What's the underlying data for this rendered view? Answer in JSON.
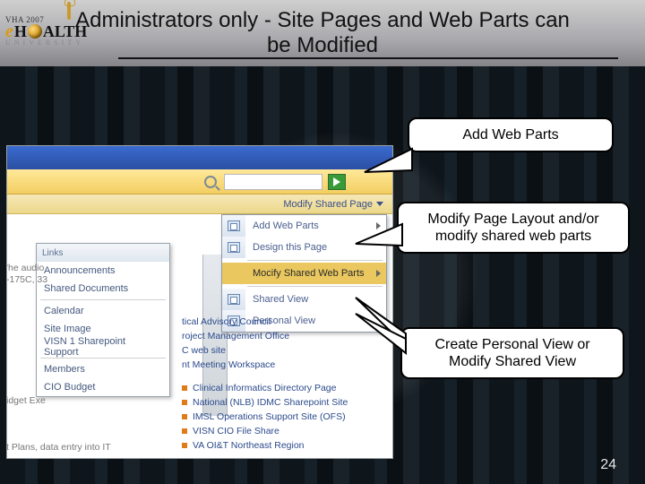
{
  "logo": {
    "year": "VHA 2007",
    "brand_e": "e",
    "brand_rest1": "H",
    "brand_rest2": "ALTH",
    "sub": "UNIVERSITY"
  },
  "title": "Administrators only - Site Pages and Web Parts can be Modified",
  "search": {
    "placeholder": ""
  },
  "modify_link": "Modify Shared Page",
  "dropdown": [
    {
      "label": "Add Web Parts",
      "arrow": true
    },
    {
      "label": "Design this Page",
      "arrow": false
    },
    {
      "label": "Mocify Shared Web Parts",
      "arrow": true,
      "hover": true
    },
    {
      "label": "Shared View",
      "arrow": false
    },
    {
      "label": "Personal View",
      "arrow": false
    }
  ],
  "sidemenu": {
    "header": "Links",
    "items": [
      "Announcements",
      "Shared Documents",
      "Calendar",
      "Site Image",
      "VISN 1 Sharepoint Support",
      "Members",
      "CIO Budget"
    ]
  },
  "cut": {
    "one_l1": "'he audio",
    "one_l2": "-175C, 33",
    "two": "idget Exe",
    "three": "t Plans, data entry into IT"
  },
  "rightlist_top": [
    "tical Advisory Council",
    "roject Management Office",
    "C web site",
    "nt Meeting Workspace"
  ],
  "rightlist_bottom": [
    "Clinical Informatics Directory Page",
    "National (NLB) IDMC Sharepoint Site",
    "IMSL Operations Support Site (OFS)",
    "VISN CIO File Share",
    "VA OI&T Northeast Region"
  ],
  "callouts": {
    "c1": "Add Web Parts",
    "c2": "Modify Page Layout and/or modify shared web parts",
    "c3": "Create Personal View or Modify Shared View"
  },
  "page_number": "24"
}
